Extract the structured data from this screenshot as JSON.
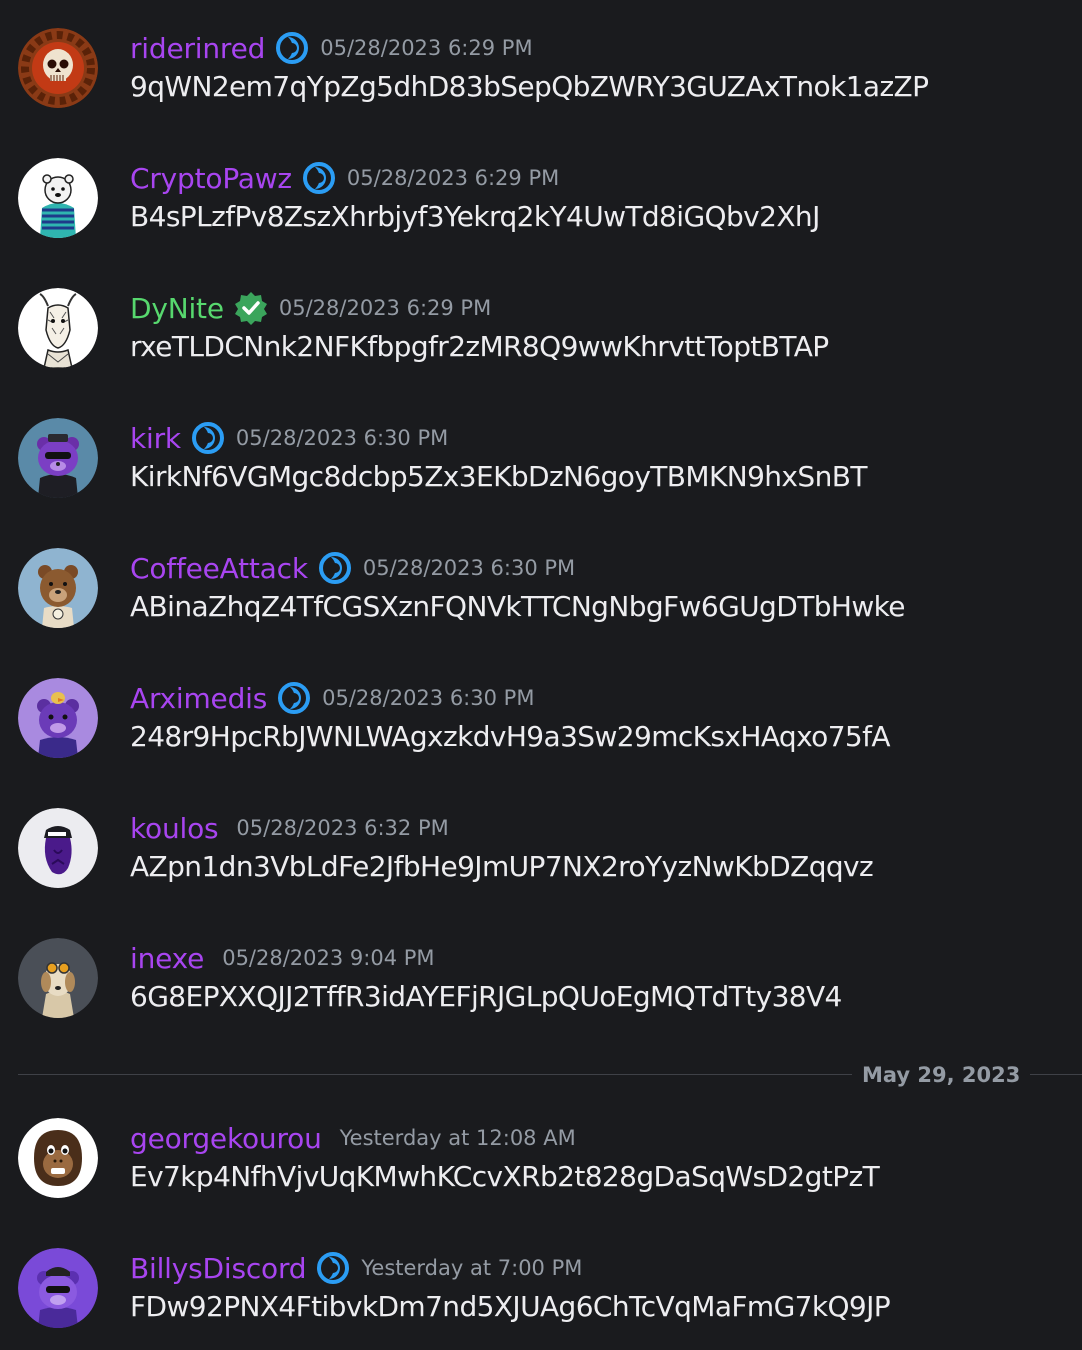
{
  "messages": [
    {
      "username": "riderinred",
      "badge": "nitro-icon",
      "timestamp": "05/28/2023 6:29 PM",
      "content": "9qWN2em7qYpZg5dhD83bSepQbZWRY3GUZAxTnok1azZP",
      "avatar": "skull-avatar"
    },
    {
      "username": "CryptoPawz",
      "badge": "nitro-icon",
      "timestamp": "05/28/2023 6:29 PM",
      "content": "B4sPLzfPv8ZszXhrbjyf3Yekrq2kY4UwTd8iGQbv2XhJ",
      "avatar": "bear-hoodie-avatar"
    },
    {
      "username": "DyNite",
      "badge": "verified-icon",
      "timestamp": "05/28/2023 6:29 PM",
      "content": "rxeTLDCNnk2NFKfbpgfr2zMR8Q9wwKhrvttToptBTAP",
      "avatar": "goat-sketch-avatar"
    },
    {
      "username": "kirk",
      "badge": "nitro-icon",
      "timestamp": "05/28/2023 6:30 PM",
      "content": "KirkNf6VGMgc8dcbp5Zx3EKbDzN6goyTBMKN9hxSnBT",
      "avatar": "purple-bear-avatar"
    },
    {
      "username": "CoffeeAttack",
      "badge": "nitro-icon",
      "timestamp": "05/28/2023 6:30 PM",
      "content": "ABinaZhqZ4TfCGSXznFQNVkTTCNgNbgFw6GUgDTbHwke",
      "avatar": "brown-bear-avatar"
    },
    {
      "username": "Arximedis",
      "badge": "nitro-icon",
      "timestamp": "05/28/2023 6:30 PM",
      "content": "248r9HpcRbJWNLWAgxzkdvH9a3Sw29mcKsxHAqxo75fA",
      "avatar": "purple-bear-chick-avatar"
    },
    {
      "username": "koulos",
      "badge": "",
      "timestamp": "05/28/2023 6:32 PM",
      "content": "AZpn1dn3VbLdFe2JfbHe9JmUP7NX2roYyzNwKbDZqqvz",
      "avatar": "purple-head-avatar"
    },
    {
      "username": "inexe",
      "badge": "",
      "timestamp": "05/28/2023 9:04 PM",
      "content": "6G8EPXXQJJ2TffR3idAYEFjRJGLpQUoEgMQTdTty38V4",
      "avatar": "dog-goggles-avatar"
    },
    {
      "username": "georgekourou",
      "badge": "",
      "timestamp": "Yesterday at 12:08 AM",
      "content": "Ev7kp4NfhVjvUqKMwhKCcvXRb2t828gDaSqWsD2gtPzT",
      "avatar": "monkey-avatar"
    },
    {
      "username": "BillysDiscord",
      "badge": "nitro-icon",
      "timestamp": "Yesterday at 7:00 PM",
      "content": "FDw92PNX4FtibvkDm7nd5XJUAg6ChTcVqMaFmG7kQ9JP",
      "avatar": "purple-bear-hat-avatar"
    }
  ],
  "divider": {
    "label": "May 29, 2023"
  },
  "colors": {
    "background": "#1a1b1e",
    "username": "#a845f0",
    "username_verified": "#57d86e",
    "timestamp": "#949ba4",
    "message_text": "#ededf0",
    "nitro_badge": "#2b9df4",
    "verified_badge": "#3ba55c"
  }
}
